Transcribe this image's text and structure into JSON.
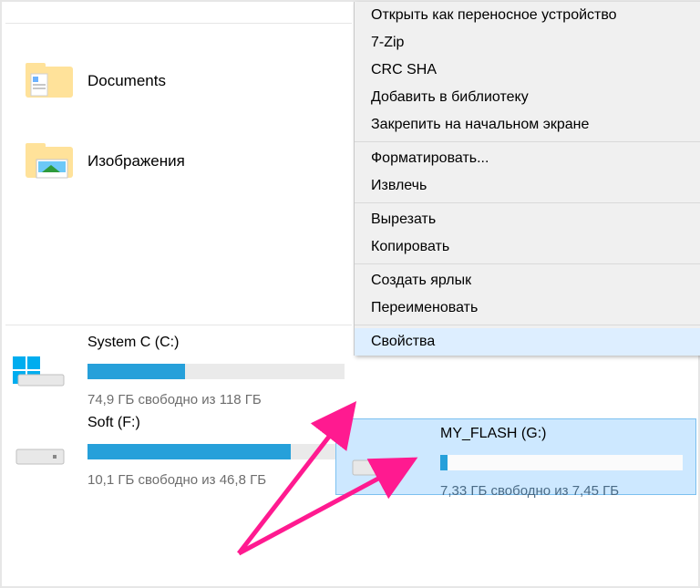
{
  "folders": [
    {
      "label": "Documents",
      "icon": "documents"
    },
    {
      "label": "Изображения",
      "icon": "pictures"
    }
  ],
  "drives": [
    {
      "name": "System C (C:)",
      "free": "74,9 ГБ свободно из 118 ГБ",
      "fill": 38,
      "icon": "system"
    },
    {
      "name": "Soft (F:)",
      "free": "10,1 ГБ свободно из 46,8 ГБ",
      "fill": 79,
      "icon": "hdd"
    }
  ],
  "flash": {
    "name": "MY_FLASH (G:)",
    "free": "7,33 ГБ свободно из 7,45 ГБ",
    "fill": 3
  },
  "menu": {
    "items": [
      {
        "label": "Открыть как переносное устройство"
      },
      {
        "label": "7-Zip"
      },
      {
        "label": "CRC SHA"
      },
      {
        "label": "Добавить в библиотеку"
      },
      {
        "label": "Закрепить на начальном экране"
      },
      {
        "sep": true
      },
      {
        "label": "Форматировать..."
      },
      {
        "label": "Извлечь"
      },
      {
        "sep": true
      },
      {
        "label": "Вырезать"
      },
      {
        "label": "Копировать"
      },
      {
        "sep": true
      },
      {
        "label": "Создать ярлык"
      },
      {
        "label": "Переименовать"
      },
      {
        "sep": true
      },
      {
        "label": "Свойства",
        "highlight": true
      }
    ]
  }
}
